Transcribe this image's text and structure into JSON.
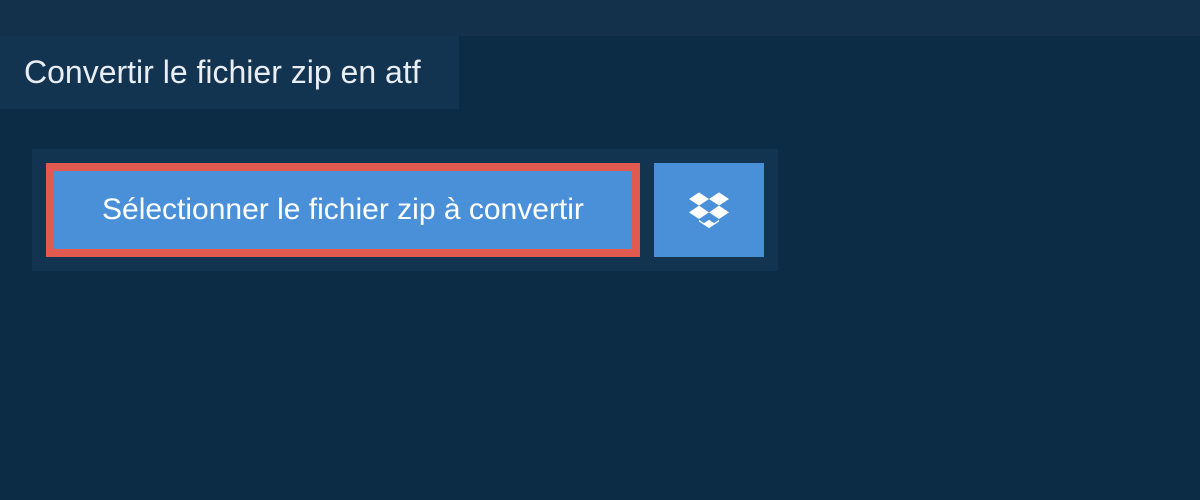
{
  "header": {
    "title": "Convertir le fichier zip en atf"
  },
  "main": {
    "select_button_label": "Sélectionner le fichier zip à convertir"
  },
  "colors": {
    "page_bg": "#0c2b44",
    "panel_bg": "#133450",
    "button_bg": "#4a90d9",
    "highlight_border": "#e05a4f"
  }
}
